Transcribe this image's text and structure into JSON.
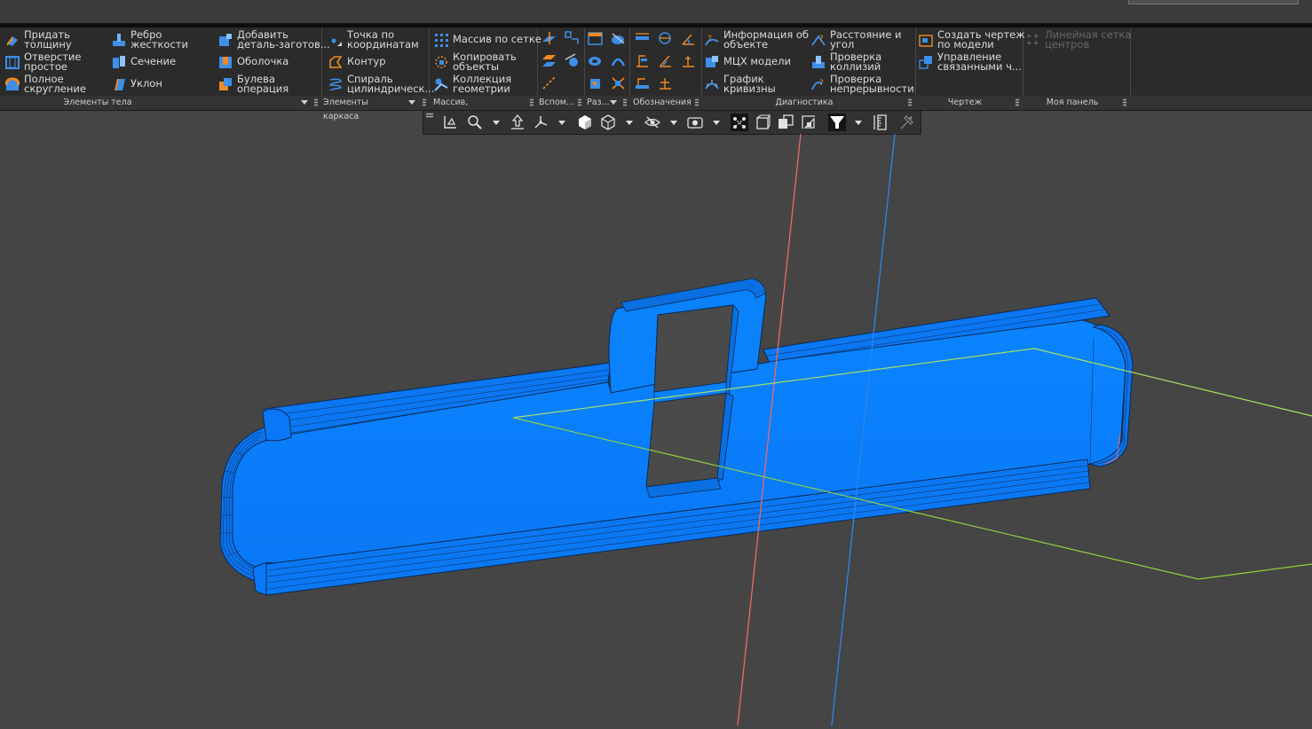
{
  "ribbon": {
    "body_group": {
      "label": "Элементы тела",
      "items": [
        {
          "label": "Придать\nтолщину",
          "icon": "thicken-icon"
        },
        {
          "label": "Отверстие\nпростое",
          "icon": "hole-icon"
        },
        {
          "label": "Полное\nскругление",
          "icon": "full-fillet-icon"
        },
        {
          "label": "Ребро\nжесткости",
          "icon": "rib-icon"
        },
        {
          "label": "Сечение",
          "icon": "section-icon"
        },
        {
          "label": "Уклон",
          "icon": "draft-icon"
        },
        {
          "label": "Добавить\nдеталь-заготов...",
          "icon": "add-part-icon"
        },
        {
          "label": "Оболочка",
          "icon": "shell-icon"
        },
        {
          "label": "Булева\nоперация",
          "icon": "boolean-icon"
        }
      ]
    },
    "frame_group": {
      "label": "Элементы каркаса",
      "items": [
        {
          "label": "Точка по\nкоординатам",
          "icon": "point-icon"
        },
        {
          "label": "Контур",
          "icon": "contour-icon"
        },
        {
          "label": "Спираль\nцилиндрическ...",
          "icon": "spiral-icon"
        }
      ]
    },
    "array_group": {
      "label": "Массив, копирование",
      "items": [
        {
          "label": "Массив по сетке",
          "icon": "grid-array-icon"
        },
        {
          "label": "Копировать\nобъекты",
          "icon": "copy-objects-icon"
        },
        {
          "label": "Коллекция\nгеометрии",
          "icon": "geometry-collection-icon"
        }
      ]
    },
    "aux_group": {
      "label": "Вспом..."
    },
    "split_group": {
      "label": "Раз..."
    },
    "notation_group": {
      "label": "Обозначения"
    },
    "diag_group": {
      "label": "Диагностика",
      "items": [
        {
          "label": "Информация об\nобъекте",
          "icon": "object-info-icon"
        },
        {
          "label": "МЦХ модели",
          "icon": "mass-properties-icon"
        },
        {
          "label": "График\nкривизны",
          "icon": "curvature-graph-icon"
        },
        {
          "label": "Расстояние и\nугол",
          "icon": "distance-angle-icon"
        },
        {
          "label": "Проверка\nколлизий",
          "icon": "collision-check-icon"
        },
        {
          "label": "Проверка\nнепрерывности",
          "icon": "continuity-check-icon"
        }
      ]
    },
    "drawing_group": {
      "label": "Чертеж",
      "items": [
        {
          "label": "Создать чертеж\nпо модели",
          "icon": "create-drawing-icon"
        },
        {
          "label": "Управление\nсвязанными ч...",
          "icon": "manage-linked-icon"
        }
      ]
    },
    "mypanel_group": {
      "label": "Моя панель",
      "items": [
        {
          "label": "Линейная сетка\nцентров",
          "icon": "linear-center-grid-icon"
        }
      ]
    }
  },
  "colors": {
    "background": "#454545",
    "ribbon": "#2b2b2b",
    "model_face": "#0a7cfe",
    "axis_x": "#e86a6a",
    "axis_z": "#2f86e8",
    "plane": "#8fd13d"
  }
}
